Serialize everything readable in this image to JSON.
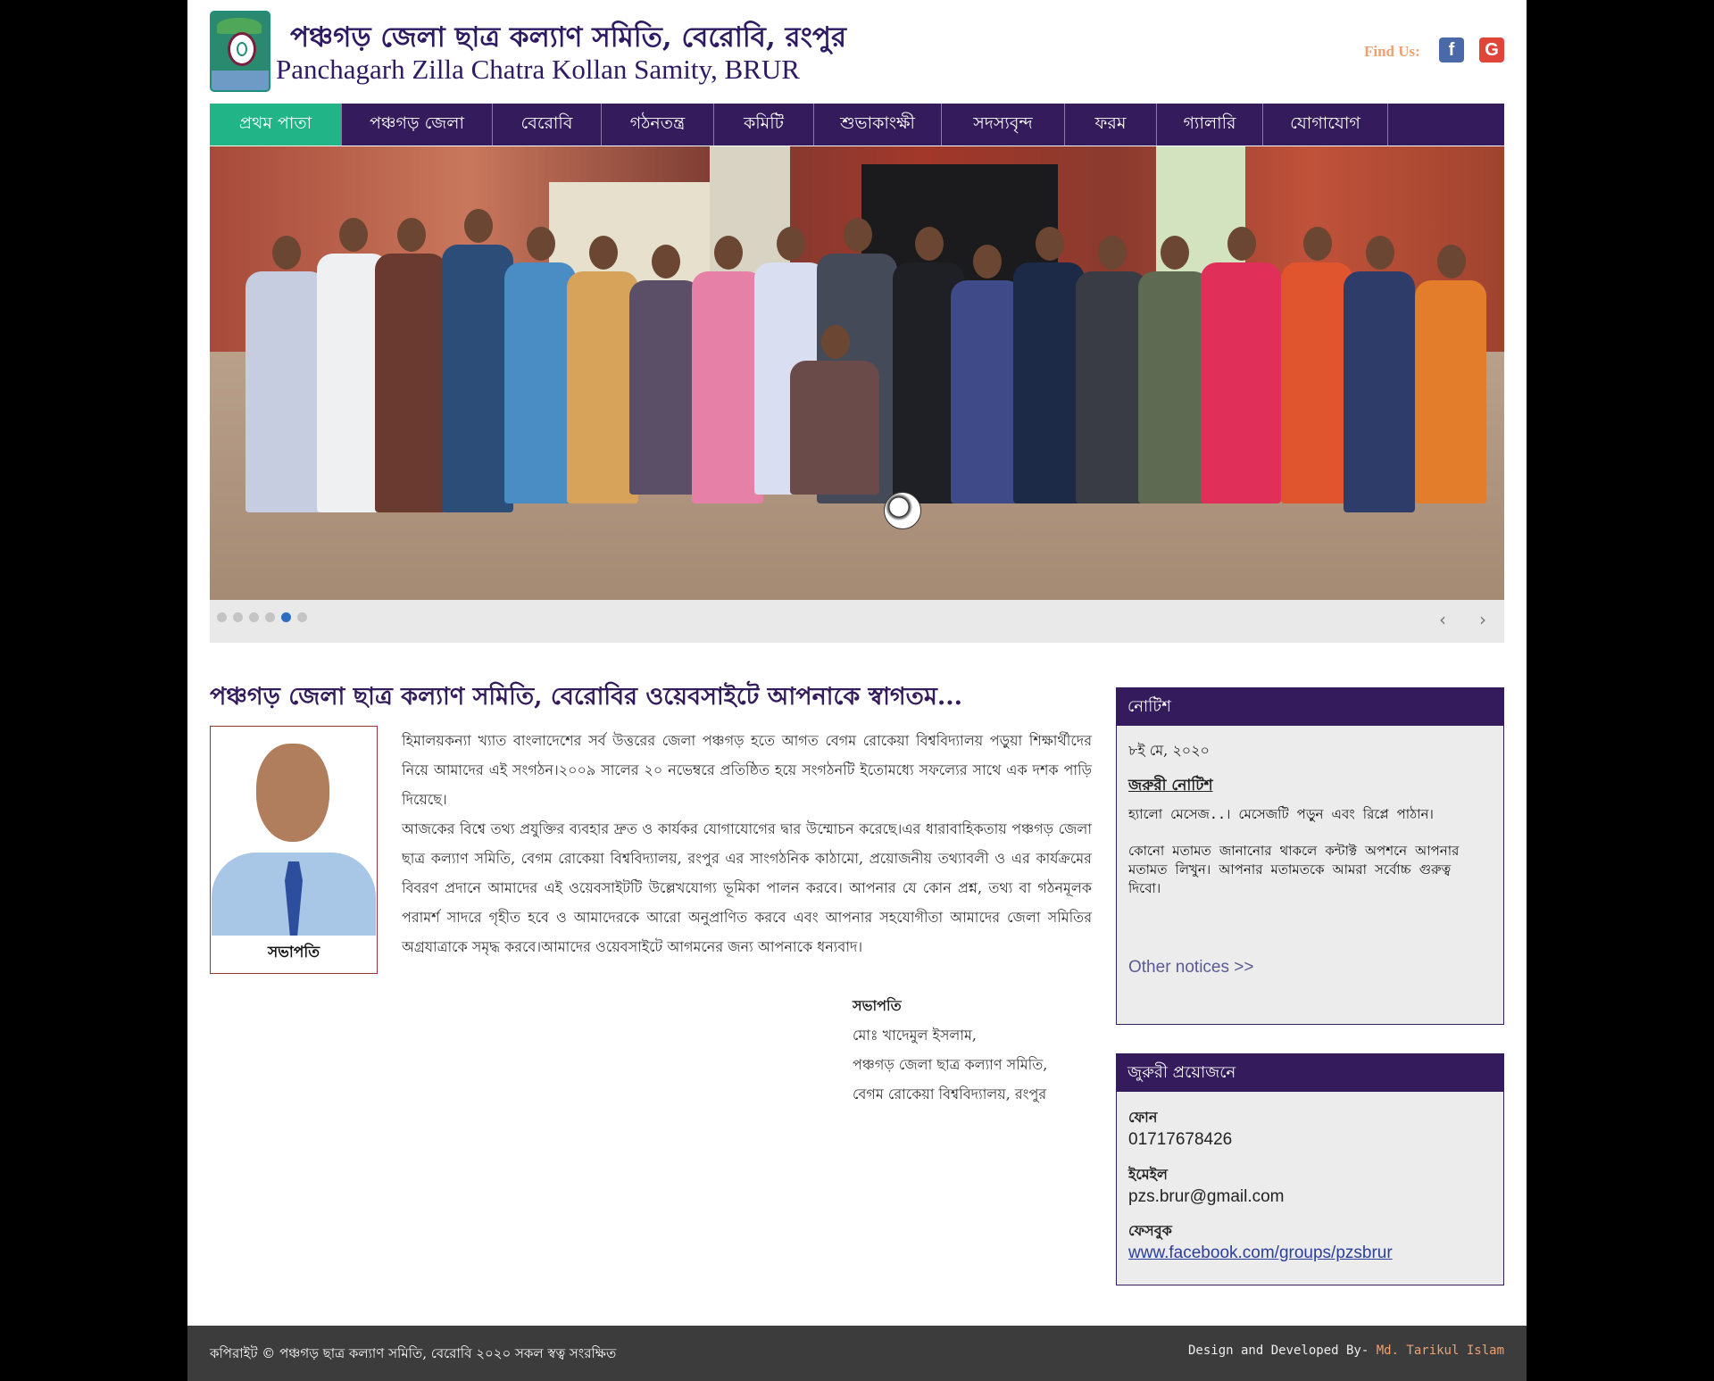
{
  "header": {
    "title_bn": "পঞ্চগড় জেলা ছাত্র কল্যাণ সমিতি, বেরোবি, রংপুর",
    "title_en": "Panchagarh Zilla Chatra Kollan Samity, BRUR",
    "find_us": "Find Us:",
    "facebook_icon": "f",
    "google_icon": "G"
  },
  "nav": {
    "items": [
      {
        "label": "প্রথম পাতা",
        "active": true
      },
      {
        "label": "পঞ্চগড় জেলা"
      },
      {
        "label": "বেরোবি"
      },
      {
        "label": "গঠনতন্ত্র"
      },
      {
        "label": "কমিটি"
      },
      {
        "label": "শুভাকাংক্ষী"
      },
      {
        "label": "সদস্যবৃন্দ"
      },
      {
        "label": "ফরম"
      },
      {
        "label": "গ্যালারি"
      },
      {
        "label": "যোগাযোগ"
      }
    ]
  },
  "slider": {
    "active_slide": 5,
    "slide_count": 6,
    "prev": "‹",
    "next": "›"
  },
  "welcome": {
    "heading": "পঞ্চগড় জেলা ছাত্র কল্যাণ সমিতি, বেরোবির ওয়েবসাইটে আপনাকে স্বাগতম...",
    "president_caption": "সভাপতি",
    "paragraph1": "হিমালয়কন্যা খ্যাত বাংলাদেশের সর্ব উত্তরের জেলা পঞ্চগড় হতে আগত বেগম রোকেয়া বিশ্ববিদ্যালয় পড়ুয়া শিক্ষার্থীদের নিয়ে আমাদের এই সংগঠন।২০০৯ সালের ২০ নভেম্বরে প্রতিষ্ঠিত হয়ে সংগঠনটি ইতোমধ্যে সফল্যের সাথে এক দশক পাড়ি দিয়েছে।",
    "paragraph2": "আজকের বিশ্বে তথ্য প্রযুক্তির ব্যবহার দ্রুত ও কার্যকর যোগাযোগের দ্বার উম্মোচন করেছে।এর ধারাবাহিকতায় পঞ্চগড় জেলা ছাত্র কল্যাণ সমিতি, বেগম রোকেয়া বিশ্ববিদ্যালয়, রংপুর এর সাংগঠনিক কাঠামো, প্রয়োজনীয় তথ্যাবলী ও এর কার্যক্রমের বিবরণ প্রদানে আমাদের এই ওয়েবসাইটটি উল্লেখযোগ্য ভূমিকা পালন করবে। আপনার যে কোন প্রশ্ন, তথ্য বা গঠনমূলক পরামর্শ সাদরে গৃহীত হবে ও আমাদেরকে আরো অনুপ্রাণিত করবে এবং আপনার সহযোগীতা আমাদের জেলা সমিতির অগ্রযাত্রাকে সমৃদ্ধ করবে।আমাদের ওয়েবসাইটে আগমনের জন্য আপনাকে ধন্যবাদ।",
    "sign_role": "সভাপতি",
    "sign_name": "মোঃ খাদেমুল ইসলাম,",
    "sign_org": "পঞ্চগড় জেলা ছাত্র কল্যাণ সমিতি,",
    "sign_univ": "বেগম রোকেয়া বিশ্ববিদ্যালয়, রংপুর"
  },
  "notice": {
    "heading": "নোটিশ",
    "date": "৮ই মে, ২০২০",
    "title": "জরুরী নোটিশ",
    "message": "হ্যালো মেসেজ..। মেসেজটি পড়ুন এবং রিপ্লে পাঠান।",
    "body": "কোনো মতামত জানানোর থাকলে কন্টাক্ট অপশনে আপনার মতামত লিখুন। আপনার মতামতকে আমরা সর্বোচ্চ গুরুত্ব দিবো।",
    "more": "Other notices >>"
  },
  "contact": {
    "heading": "জুরুরী প্রয়োজনে",
    "phone_label": "ফোন",
    "phone": "01717678426",
    "email_label": "ইমেইল",
    "email": "pzs.brur@gmail.com",
    "facebook_label": "ফেসবুক",
    "facebook": "www.facebook.com/groups/pzsbrur"
  },
  "footer": {
    "copyright": "কপিরাইট © পঞ্চগড় ছাত্র কল্যাণ সমিতি, বেরোবি ২০২০ সকল স্বত্ব সংরক্ষিত",
    "dev_prefix": "Design and Developed By- ",
    "dev_name": "Md. Tarikul Islam"
  }
}
